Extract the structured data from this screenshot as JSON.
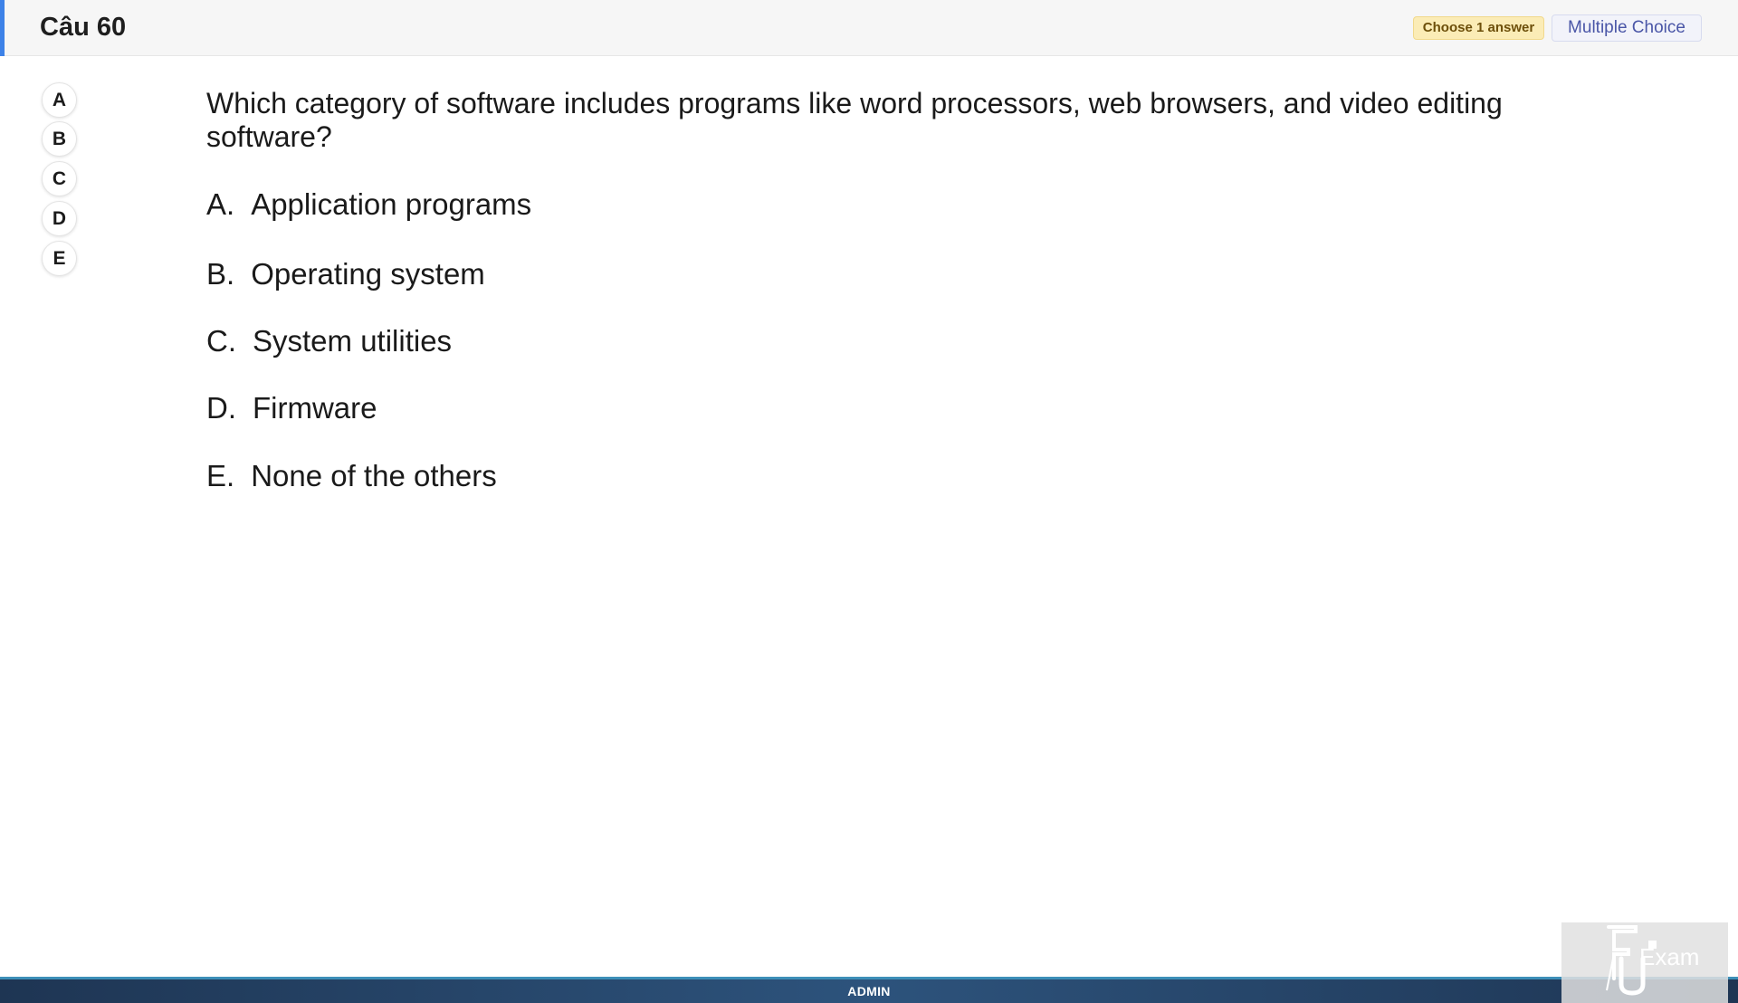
{
  "header": {
    "question_number": "Câu 60",
    "badge_choose": "Choose 1 answer",
    "badge_type": "Multiple Choice"
  },
  "selectors": [
    "A",
    "B",
    "C",
    "D",
    "E"
  ],
  "question": {
    "text": "Which category of software includes programs like word processors, web browsers, and video editing software?",
    "options": [
      {
        "letter": "A.",
        "text": "Application programs"
      },
      {
        "letter": "B.",
        "text": "Operating system"
      },
      {
        "letter": "C.",
        "text": "System utilities"
      },
      {
        "letter": "D.",
        "text": "Firmware"
      },
      {
        "letter": "E.",
        "text": "None of the others"
      }
    ]
  },
  "footer": {
    "label": "ADMIN"
  },
  "logo": {
    "text": "Exam"
  },
  "colors": {
    "accent": "#3d82e8",
    "badge_choose_bg": "#fbecb6",
    "badge_type_text": "#4a56a7",
    "footer_bg": "#2d537c"
  }
}
